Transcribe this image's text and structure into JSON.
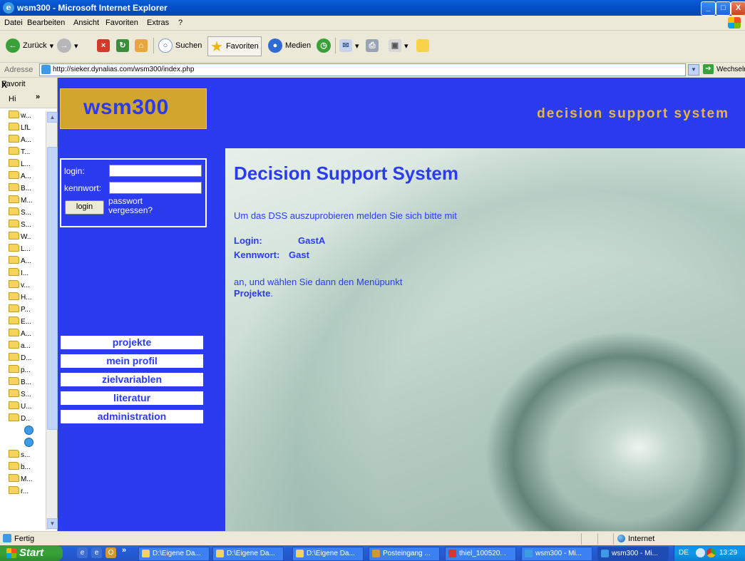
{
  "window": {
    "title": "wsm300 - Microsoft Internet Explorer",
    "minimize": "_",
    "maximize": "□",
    "close": "X"
  },
  "menu": [
    "Datei",
    "Bearbeiten",
    "Ansicht",
    "Favoriten",
    "Extras",
    "?"
  ],
  "toolbar": {
    "back": "Zurück",
    "search": "Suchen",
    "favorites": "Favoriten",
    "media": "Medien"
  },
  "address": {
    "label": "Adresse",
    "url": "http://sieker.dynalias.com/wsm300/index.php",
    "go": "Wechseln zu"
  },
  "favorites_pane": {
    "title": "Favorit",
    "close": "X",
    "add": "Hi",
    "more": "»",
    "items": [
      "w...",
      "LfL",
      "A...",
      "T...",
      "L...",
      "A...",
      "B...",
      "M...",
      "S...",
      "S...",
      "W..",
      "L...",
      "A...",
      "I...",
      "v...",
      "H...",
      "P...",
      "E...",
      "A...",
      "a...",
      "D...",
      "p...",
      "B...",
      "S...",
      "U...",
      "D..",
      "",
      "",
      "s...",
      "b...",
      "M...",
      "r..."
    ]
  },
  "site": {
    "logo": "wsm300",
    "tagline": "decision support system",
    "login": {
      "login_label": "login:",
      "password_label": "kennwort:",
      "button": "login",
      "forgot_line1": "passwort",
      "forgot_line2": "vergessen?"
    },
    "nav": [
      "projekte",
      "mein profil",
      "zielvariablen",
      "literatur",
      "administration"
    ],
    "main": {
      "heading": "Decision Support System",
      "intro": "Um das DSS auszuprobieren melden Sie sich bitte mit",
      "login_key": "Login:",
      "login_value": "GastA",
      "password_key": "Kennwort:",
      "password_value": "Gast",
      "outro": "an, und wählen Sie dann den Menüpunkt",
      "menu_item": "Projekte",
      "period": "."
    }
  },
  "status": {
    "text": "Fertig",
    "zone": "Internet"
  },
  "taskbar": {
    "start": "Start",
    "more": "»",
    "tasks": [
      "D:\\Eigene Da...",
      "D:\\Eigene Da...",
      "D:\\Eigene Da...",
      "Posteingang ...",
      "thiel_100520...",
      "wsm300 - Mi...",
      "wsm300 - Mi..."
    ],
    "lang": "DE",
    "clock": "13:29"
  },
  "colors": {
    "site_blue": "#2b3bf0",
    "logo_gold": "#d2a62c",
    "tagline_gold": "#e9b73b"
  }
}
